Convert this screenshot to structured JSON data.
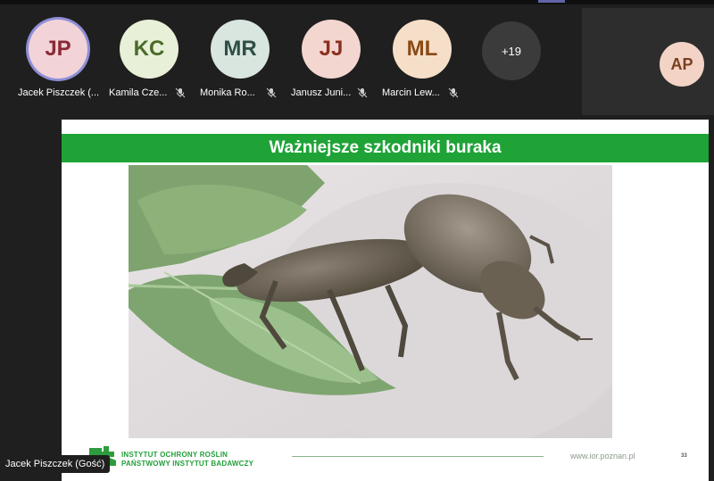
{
  "participants": [
    {
      "initials": "JP",
      "name": "Jacek Piszczek (...",
      "muted": false,
      "active": true,
      "bg": "#f2d3d8",
      "fg": "#8a2a36"
    },
    {
      "initials": "KC",
      "name": "Kamila Cze...",
      "muted": true,
      "active": false,
      "bg": "#e8f0d8",
      "fg": "#4a6a2a"
    },
    {
      "initials": "MR",
      "name": "Monika Ro...",
      "muted": true,
      "active": false,
      "bg": "#d9e6e0",
      "fg": "#2f4f45"
    },
    {
      "initials": "JJ",
      "name": "Janusz Juni...",
      "muted": true,
      "active": false,
      "bg": "#f4d6d0",
      "fg": "#8a3020"
    },
    {
      "initials": "ML",
      "name": "Marcin Lew...",
      "muted": true,
      "active": false,
      "bg": "#f6dfc8",
      "fg": "#8a4a15"
    }
  ],
  "more_count": "+19",
  "self_initials": "AP",
  "slide": {
    "title": "Ważniejsze szkodniki buraka",
    "org_line1": "INSTYTUT OCHRONY ROŚLIN",
    "org_line2": "PAŃSTWOWY INSTYTUT BADAWCZY",
    "url": "www.ior.poznan.pl",
    "page_number": "33"
  },
  "presenter_label": "Jacek Piszczek (Gość)",
  "colors": {
    "accent": "#6264a7",
    "slide_green": "#1fa337"
  }
}
